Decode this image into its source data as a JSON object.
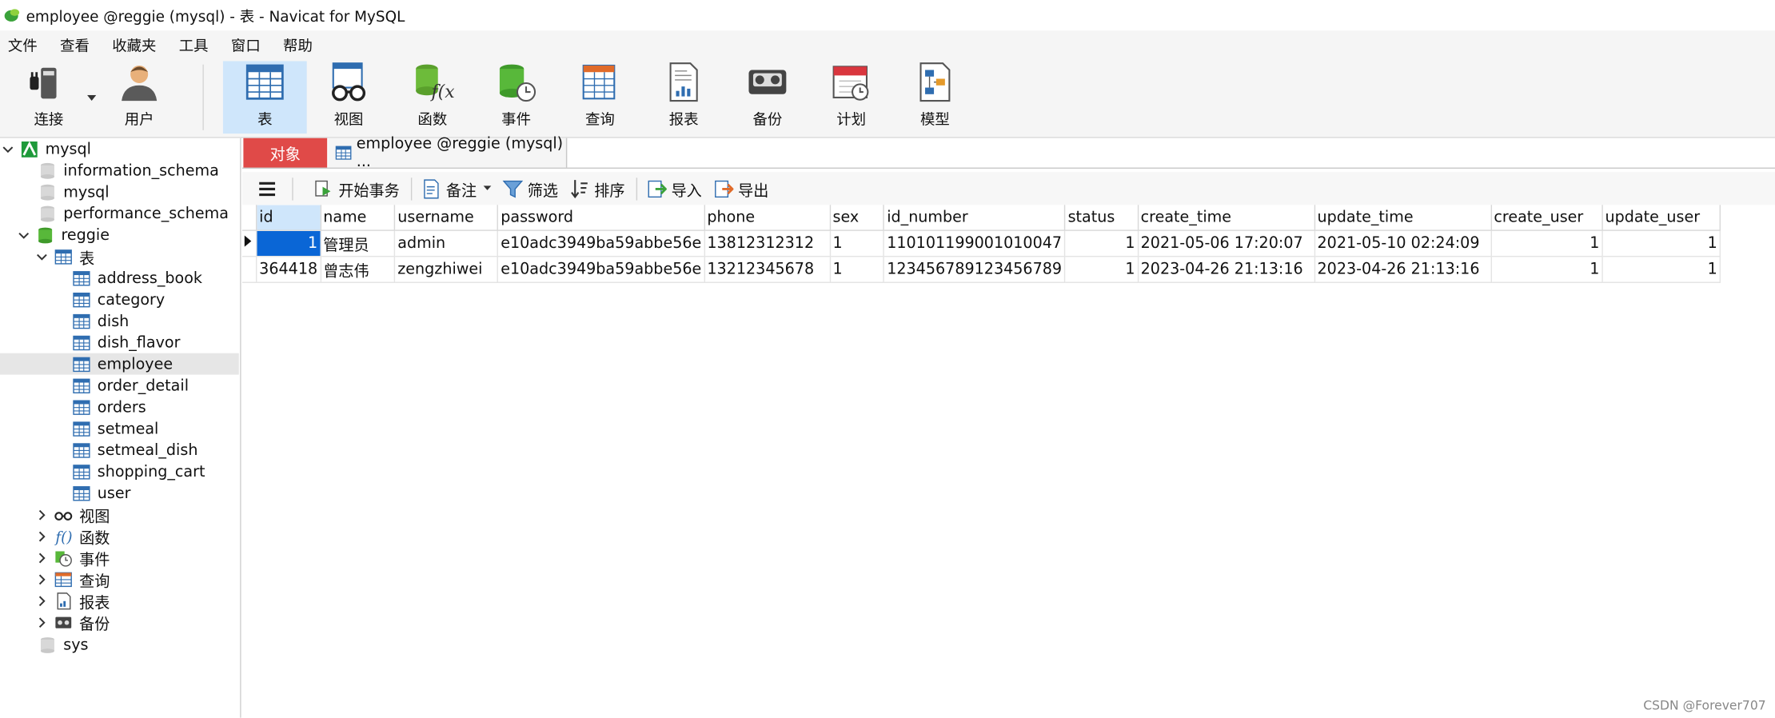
{
  "window": {
    "title": "employee @reggie (mysql) - 表 - Navicat for MySQL"
  },
  "menu": [
    "文件",
    "查看",
    "收藏夹",
    "工具",
    "窗口",
    "帮助"
  ],
  "toolbar": {
    "connect": "连接",
    "user": "用户",
    "table": "表",
    "view": "视图",
    "function": "函数",
    "event": "事件",
    "query": "查询",
    "report": "报表",
    "backup": "备份",
    "schedule": "计划",
    "model": "模型"
  },
  "tree": {
    "mysql_conn": "mysql",
    "information_schema": "information_schema",
    "mysql_db": "mysql",
    "performance_schema": "performance_schema",
    "reggie": "reggie",
    "tables_node": "表",
    "tables": [
      "address_book",
      "category",
      "dish",
      "dish_flavor",
      "employee",
      "order_detail",
      "orders",
      "setmeal",
      "setmeal_dish",
      "shopping_cart",
      "user"
    ],
    "views": "视图",
    "functions": "函数",
    "events": "事件",
    "queries": "查询",
    "reports": "报表",
    "backups": "备份",
    "sys": "sys"
  },
  "tabs": {
    "objects": "对象",
    "employee": "employee @reggie (mysql) ..."
  },
  "subtoolbar": {
    "begin_tx": "开始事务",
    "note": "备注",
    "filter": "筛选",
    "sort": "排序",
    "import": "导入",
    "export": "导出"
  },
  "table": {
    "columns": [
      "id",
      "name",
      "username",
      "password",
      "phone",
      "sex",
      "id_number",
      "status",
      "create_time",
      "update_time",
      "create_user",
      "update_user"
    ],
    "rows": [
      [
        "1",
        "管理员",
        "admin",
        "e10adc3949ba59abbe56e",
        "13812312312",
        "1",
        "110101199001010047",
        "1",
        "2021-05-06 17:20:07",
        "2021-05-10 02:24:09",
        "1",
        "1"
      ],
      [
        "364418",
        "曾志伟",
        "zengzhiwei",
        "e10adc3949ba59abbe56e",
        "13212345678",
        "1",
        "123456789123456789",
        "1",
        "2023-04-26 21:13:16",
        "2023-04-26 21:13:16",
        "1",
        "1"
      ]
    ]
  },
  "watermark": "CSDN @Forever707"
}
